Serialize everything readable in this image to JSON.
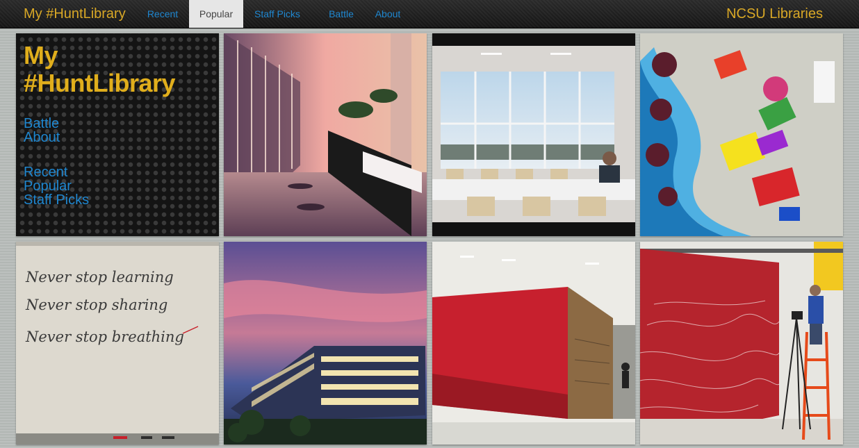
{
  "navbar": {
    "brand": "My #HuntLibrary",
    "items": [
      {
        "label": "Recent",
        "active": false
      },
      {
        "label": "Popular",
        "active": true
      },
      {
        "label": "Staff Picks",
        "active": false
      },
      {
        "label": "Battle",
        "active": false
      },
      {
        "label": "About",
        "active": false
      }
    ],
    "right_brand": "NCSU Libraries"
  },
  "intro": {
    "title_line1": "My",
    "title_line2": "#HuntLibrary",
    "links_primary": [
      "Battle",
      "About"
    ],
    "links_secondary": [
      "Recent",
      "Popular",
      "Staff Picks"
    ]
  },
  "photos": [
    {
      "name": "sunset-hallway-photo"
    },
    {
      "name": "study-room-photo"
    },
    {
      "name": "chairs-aerial-photo"
    },
    {
      "name": "whiteboard-photo",
      "lines": [
        "Never stop learning",
        "Never stop sharing",
        "Never stop breathing"
      ]
    },
    {
      "name": "library-building-dusk-photo"
    },
    {
      "name": "red-wall-photo"
    },
    {
      "name": "mural-painter-photo"
    }
  ],
  "colors": {
    "brand": "#d9a826",
    "link": "#1f87d0",
    "nav_bg": "#1d1d1d"
  }
}
